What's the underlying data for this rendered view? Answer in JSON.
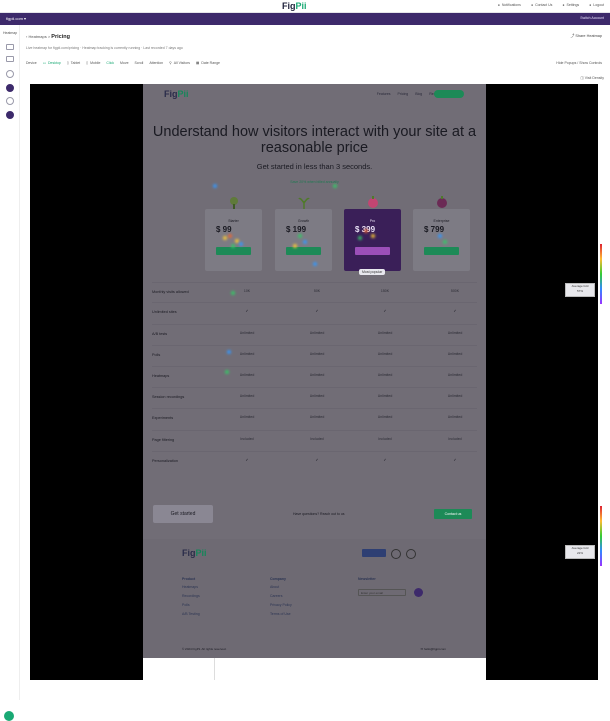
{
  "topbar": {
    "logo_main": "Fig",
    "logo_accent": "Pii",
    "nav": [
      "Notifications",
      "Contact Us",
      "Settings",
      "Logout"
    ]
  },
  "purplebar": {
    "site_label": "figpii.com",
    "right_label": "Switch Account"
  },
  "sidebar": {
    "label": "Heatmap"
  },
  "breadcrumb": {
    "parent": "Heatmaps",
    "separator": ">",
    "current": "Pricing"
  },
  "share_label": "Share Heatmap",
  "subline": "Live heatmap for figpii.com/pricing · Heatmap tracking is currently running · Last recorded 7 days ago",
  "toolbar": {
    "items": [
      "Device",
      "Desktop",
      "Tablet",
      "Mobile",
      "Click",
      "Move",
      "Scroll",
      "Attention",
      "All Visitors",
      "Date Range"
    ],
    "right": "Hide Popups / Show Controls"
  },
  "legend_top": "Visit Density",
  "page": {
    "nav": [
      "Features",
      "Pricing",
      "Blog",
      "Resources"
    ],
    "title": "Understand how visitors interact with your site at a reasonable price",
    "subtitle": "Get started in less than 3 seconds.",
    "annual_note": "Save 20% when billed annually",
    "plans": [
      {
        "name": "Starter",
        "price": "$ 99",
        "note": ""
      },
      {
        "name": "Growth",
        "price": "$ 199",
        "note": "Most popular"
      },
      {
        "name": "Pro",
        "price": "$ 399",
        "note": ""
      },
      {
        "name": "Enterprise",
        "price": "$ 799",
        "note": ""
      }
    ],
    "popular_badge": "Most popular",
    "rows": [
      {
        "label": "Monthly visits allowed",
        "cells": [
          "10K",
          "50K",
          "150K",
          "500K"
        ]
      },
      {
        "label": "Unlimited sites",
        "cells": [
          "✓",
          "✓",
          "✓",
          "✓"
        ]
      },
      {
        "label": "A/B tests",
        "cells": [
          "Unlimited",
          "Unlimited",
          "Unlimited",
          "Unlimited"
        ]
      },
      {
        "label": "Polls",
        "cells": [
          "Unlimited",
          "Unlimited",
          "Unlimited",
          "Unlimited"
        ]
      },
      {
        "label": "Heatmaps",
        "cells": [
          "Unlimited",
          "Unlimited",
          "Unlimited",
          "Unlimited"
        ]
      },
      {
        "label": "Session recordings",
        "cells": [
          "Unlimited",
          "Unlimited",
          "Unlimited",
          "Unlimited"
        ]
      },
      {
        "label": "Experiments",
        "cells": [
          "Unlimited",
          "Unlimited",
          "Unlimited",
          "Unlimited"
        ]
      },
      {
        "label": "Page filtering",
        "cells": [
          "Included",
          "Included",
          "Included",
          "Included"
        ]
      },
      {
        "label": "Personalization",
        "cells": [
          "✓",
          "✓",
          "✓",
          "✓"
        ]
      }
    ],
    "signup_label": "Get started",
    "questions_label": "Have questions? Reach out to us",
    "contact_label": "Contact us",
    "footer": {
      "logo_main": "Fig",
      "logo_accent": "Pii",
      "col1_title": "Product",
      "col1_items": [
        "Heatmaps",
        "Recordings",
        "Polls",
        "A/B Testing"
      ],
      "col2_title": "Company",
      "col2_items": [
        "About",
        "Careers",
        "Privacy Policy",
        "Terms of Use"
      ],
      "col3_title": "Newsletter",
      "input_placeholder": "Enter your email",
      "copyright": "© 2024 FigPii. All rights reserved.",
      "email": "hello@figpii.com"
    }
  },
  "side_indicators": [
    {
      "label": "Average fold",
      "value": "57%"
    },
    {
      "label": "Average fold",
      "value": "22%"
    }
  ],
  "colors": {
    "brand_purple": "#3d2a6b",
    "brand_green": "#19a974",
    "canvas_black": "#000000"
  }
}
